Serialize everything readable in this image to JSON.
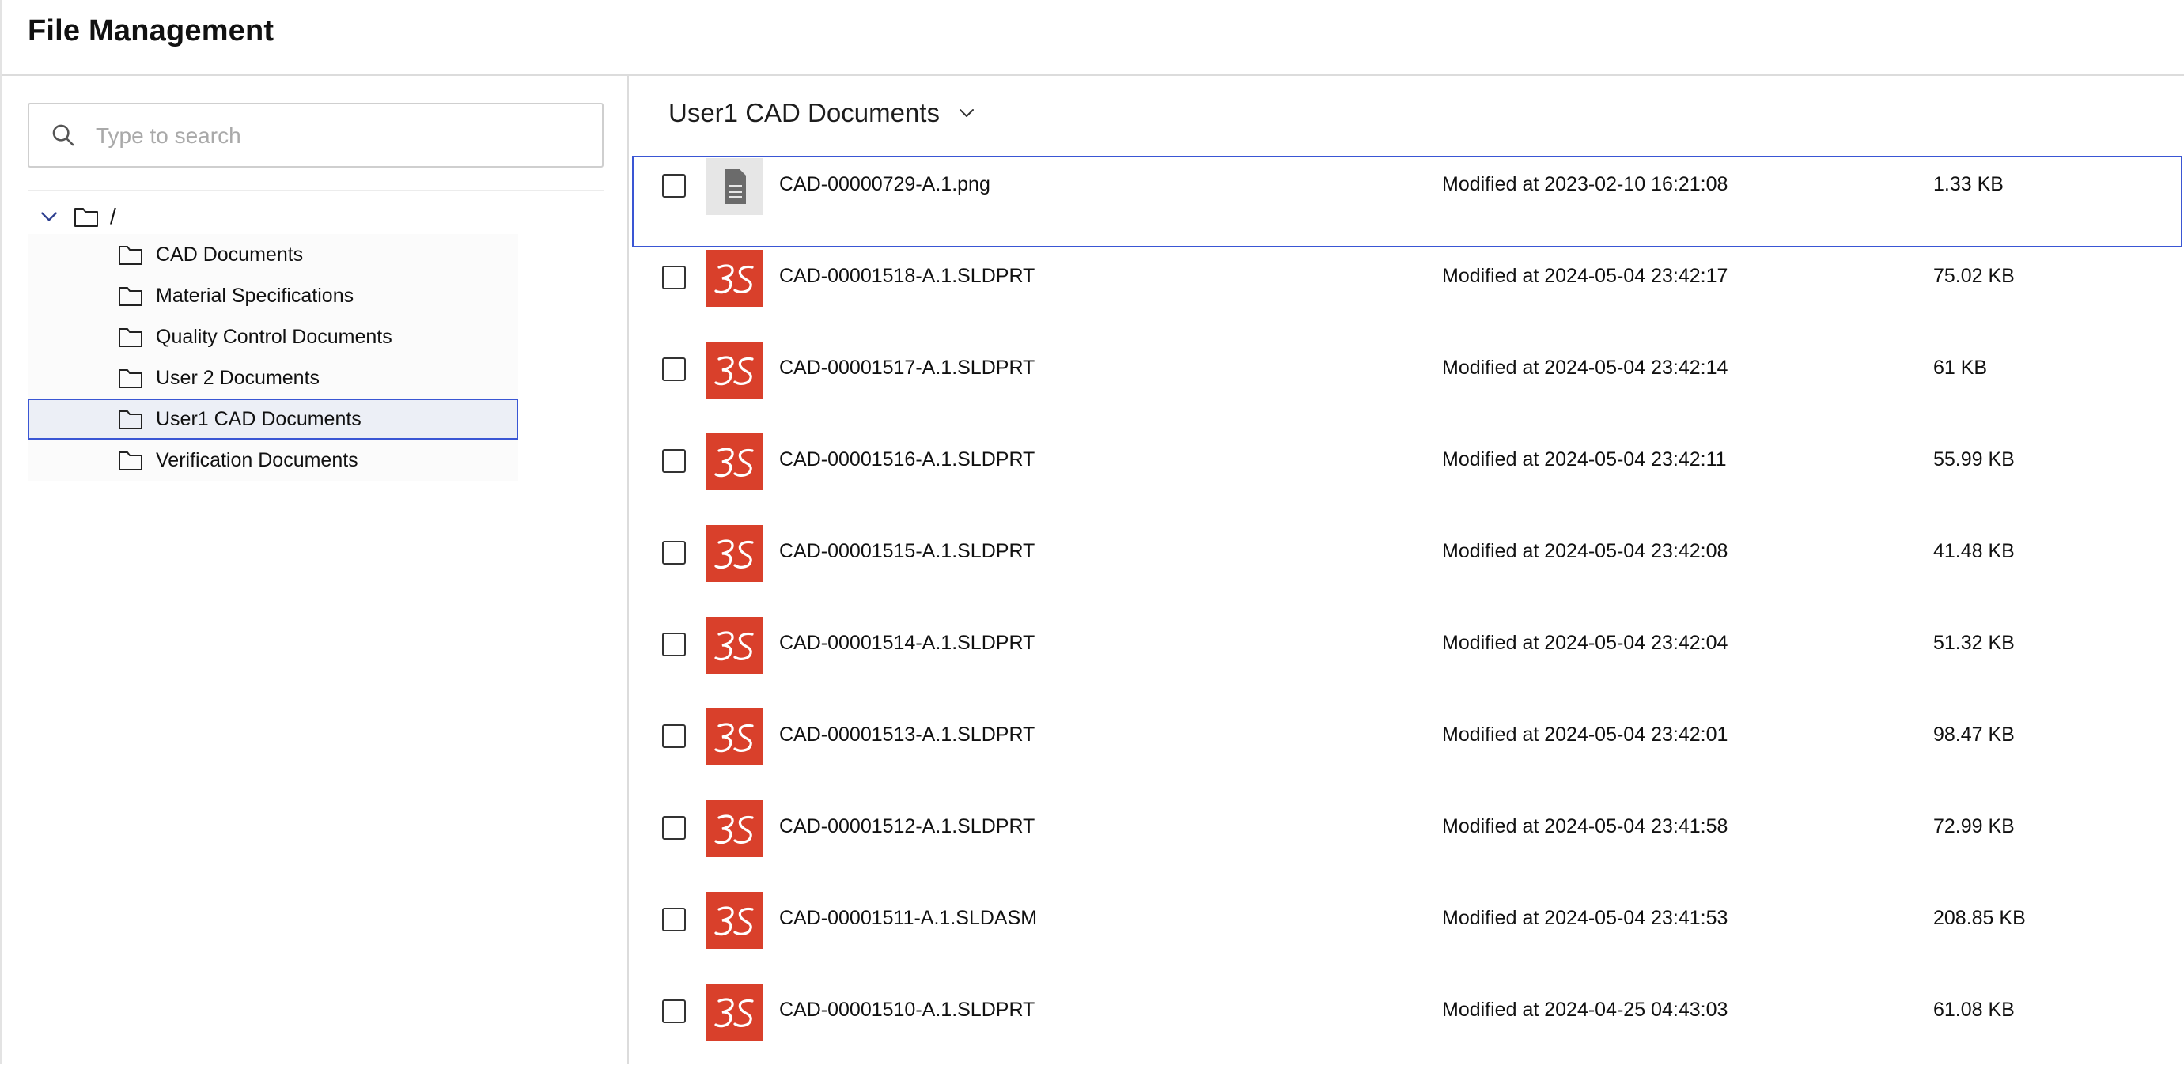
{
  "app": {
    "title": "File Management"
  },
  "sidebar": {
    "search": {
      "placeholder": "Type to search",
      "value": ""
    },
    "tree": {
      "root_label": "/",
      "expanded": true,
      "items": [
        {
          "label": "CAD Documents",
          "selected": false
        },
        {
          "label": "Material Specifications",
          "selected": false
        },
        {
          "label": "Quality Control Documents",
          "selected": false
        },
        {
          "label": "User 2 Documents",
          "selected": false
        },
        {
          "label": "User1 CAD Documents",
          "selected": true
        },
        {
          "label": "Verification Documents",
          "selected": false
        }
      ]
    }
  },
  "main": {
    "current_folder": "User1 CAD Documents",
    "files": [
      {
        "name": "CAD-00000729-A.1.png",
        "modified": "Modified at 2023-02-10 16:21:08",
        "size": "1.33 KB",
        "icon": "generic-document-icon",
        "checked": false,
        "focused": true
      },
      {
        "name": "CAD-00001518-A.1.SLDPRT",
        "modified": "Modified at 2024-05-04 23:42:17",
        "size": "75.02 KB",
        "icon": "solidworks-3ds-icon",
        "checked": false,
        "focused": false
      },
      {
        "name": "CAD-00001517-A.1.SLDPRT",
        "modified": "Modified at 2024-05-04 23:42:14",
        "size": "61 KB",
        "icon": "solidworks-3ds-icon",
        "checked": false,
        "focused": false
      },
      {
        "name": "CAD-00001516-A.1.SLDPRT",
        "modified": "Modified at 2024-05-04 23:42:11",
        "size": "55.99 KB",
        "icon": "solidworks-3ds-icon",
        "checked": false,
        "focused": false
      },
      {
        "name": "CAD-00001515-A.1.SLDPRT",
        "modified": "Modified at 2024-05-04 23:42:08",
        "size": "41.48 KB",
        "icon": "solidworks-3ds-icon",
        "checked": false,
        "focused": false
      },
      {
        "name": "CAD-00001514-A.1.SLDPRT",
        "modified": "Modified at 2024-05-04 23:42:04",
        "size": "51.32 KB",
        "icon": "solidworks-3ds-icon",
        "checked": false,
        "focused": false
      },
      {
        "name": "CAD-00001513-A.1.SLDPRT",
        "modified": "Modified at 2024-05-04 23:42:01",
        "size": "98.47 KB",
        "icon": "solidworks-3ds-icon",
        "checked": false,
        "focused": false
      },
      {
        "name": "CAD-00001512-A.1.SLDPRT",
        "modified": "Modified at 2024-05-04 23:41:58",
        "size": "72.99 KB",
        "icon": "solidworks-3ds-icon",
        "checked": false,
        "focused": false
      },
      {
        "name": "CAD-00001511-A.1.SLDASM",
        "modified": "Modified at 2024-05-04 23:41:53",
        "size": "208.85 KB",
        "icon": "solidworks-3ds-icon",
        "checked": false,
        "focused": false
      },
      {
        "name": "CAD-00001510-A.1.SLDPRT",
        "modified": "Modified at 2024-04-25 04:43:03",
        "size": "61.08 KB",
        "icon": "solidworks-3ds-icon",
        "checked": false,
        "focused": false
      }
    ]
  },
  "colors": {
    "accent": "#3a56d4",
    "selected_bg": "#eceff6",
    "solidworks_red": "#d9402b",
    "generic_icon_bg": "#e6e6e6",
    "generic_icon_fg": "#6b6b6b"
  }
}
